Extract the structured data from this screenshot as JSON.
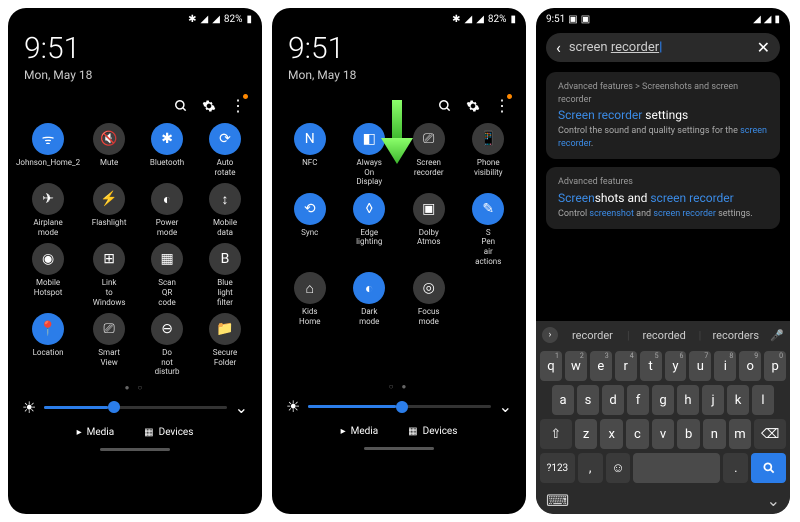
{
  "status": {
    "time": "9:51",
    "battery": "82%",
    "icons": "✱ ⌂ ◢ ◢"
  },
  "panel": {
    "time": "9:51",
    "date": "Mon, May 18"
  },
  "tiles1": [
    {
      "label": "Johnson_Home_2",
      "icon": "wifi",
      "on": true
    },
    {
      "label": "Mute",
      "icon": "mute",
      "on": false
    },
    {
      "label": "Bluetooth",
      "icon": "bt",
      "on": true
    },
    {
      "label": "Auto rotate",
      "icon": "rotate",
      "on": true
    },
    {
      "label": "Airplane mode",
      "icon": "plane",
      "on": false
    },
    {
      "label": "Flashlight",
      "icon": "flash",
      "on": false
    },
    {
      "label": "Power mode",
      "icon": "power",
      "on": false
    },
    {
      "label": "Mobile data",
      "icon": "data",
      "on": false
    },
    {
      "label": "Mobile Hotspot",
      "icon": "hotspot",
      "on": false
    },
    {
      "label": "Link to Windows",
      "icon": "link",
      "on": false
    },
    {
      "label": "Scan QR code",
      "icon": "qr",
      "on": false
    },
    {
      "label": "Blue light filter",
      "icon": "blue",
      "on": false
    },
    {
      "label": "Location",
      "icon": "loc",
      "on": true
    },
    {
      "label": "Smart View",
      "icon": "cast",
      "on": false
    },
    {
      "label": "Do not disturb",
      "icon": "dnd",
      "on": false
    },
    {
      "label": "Secure Folder",
      "icon": "folder",
      "on": false
    }
  ],
  "tiles2": [
    {
      "label": "NFC",
      "icon": "nfc",
      "on": true
    },
    {
      "label": "Always On Display",
      "icon": "aod",
      "on": true
    },
    {
      "label": "Screen recorder",
      "icon": "rec",
      "on": false
    },
    {
      "label": "Phone visibility",
      "icon": "vis",
      "on": false
    },
    {
      "label": "Sync",
      "icon": "sync",
      "on": true
    },
    {
      "label": "Edge lighting",
      "icon": "edge",
      "on": true
    },
    {
      "label": "Dolby Atmos",
      "icon": "dolby",
      "on": false
    },
    {
      "label": "S Pen air actions",
      "icon": "spen",
      "on": true
    },
    {
      "label": "Kids Home",
      "icon": "kids",
      "on": false
    },
    {
      "label": "Dark mode",
      "icon": "dark",
      "on": true
    },
    {
      "label": "Focus mode",
      "icon": "focus",
      "on": false
    }
  ],
  "brightness1": 35,
  "brightness2": 48,
  "media_label": "Media",
  "devices_label": "Devices",
  "search": {
    "query_pre": "screen ",
    "query_under": "recorder"
  },
  "results": [
    {
      "crumb": "Advanced features > Screenshots and screen recorder",
      "title_pre": "",
      "title_link": "Screen recorder",
      "title_post": " settings",
      "desc_pre": "Control the sound and quality settings for the ",
      "desc_link": "screen recorder",
      "desc_post": "."
    },
    {
      "crumb": "Advanced features",
      "title_pre": "",
      "title_link": "Screen",
      "title_mid": "shots and ",
      "title_link2": "screen recorder",
      "title_post": "",
      "desc_pre": "Control ",
      "desc_link": "screenshot",
      "desc_mid": " and ",
      "desc_link2": "screen recorder",
      "desc_post": " settings."
    }
  ],
  "suggestions": [
    "recorder",
    "recorded",
    "recorders"
  ],
  "kb": {
    "row1": [
      [
        "q",
        "1"
      ],
      [
        "w",
        "2"
      ],
      [
        "e",
        "3"
      ],
      [
        "r",
        "4"
      ],
      [
        "t",
        "5"
      ],
      [
        "y",
        "6"
      ],
      [
        "u",
        "7"
      ],
      [
        "i",
        "8"
      ],
      [
        "o",
        "9"
      ],
      [
        "p",
        "0"
      ]
    ],
    "row2": [
      "a",
      "s",
      "d",
      "f",
      "g",
      "h",
      "j",
      "k",
      "l"
    ],
    "row3": [
      "z",
      "x",
      "c",
      "v",
      "b",
      "n",
      "m"
    ],
    "numeric": "?123"
  }
}
